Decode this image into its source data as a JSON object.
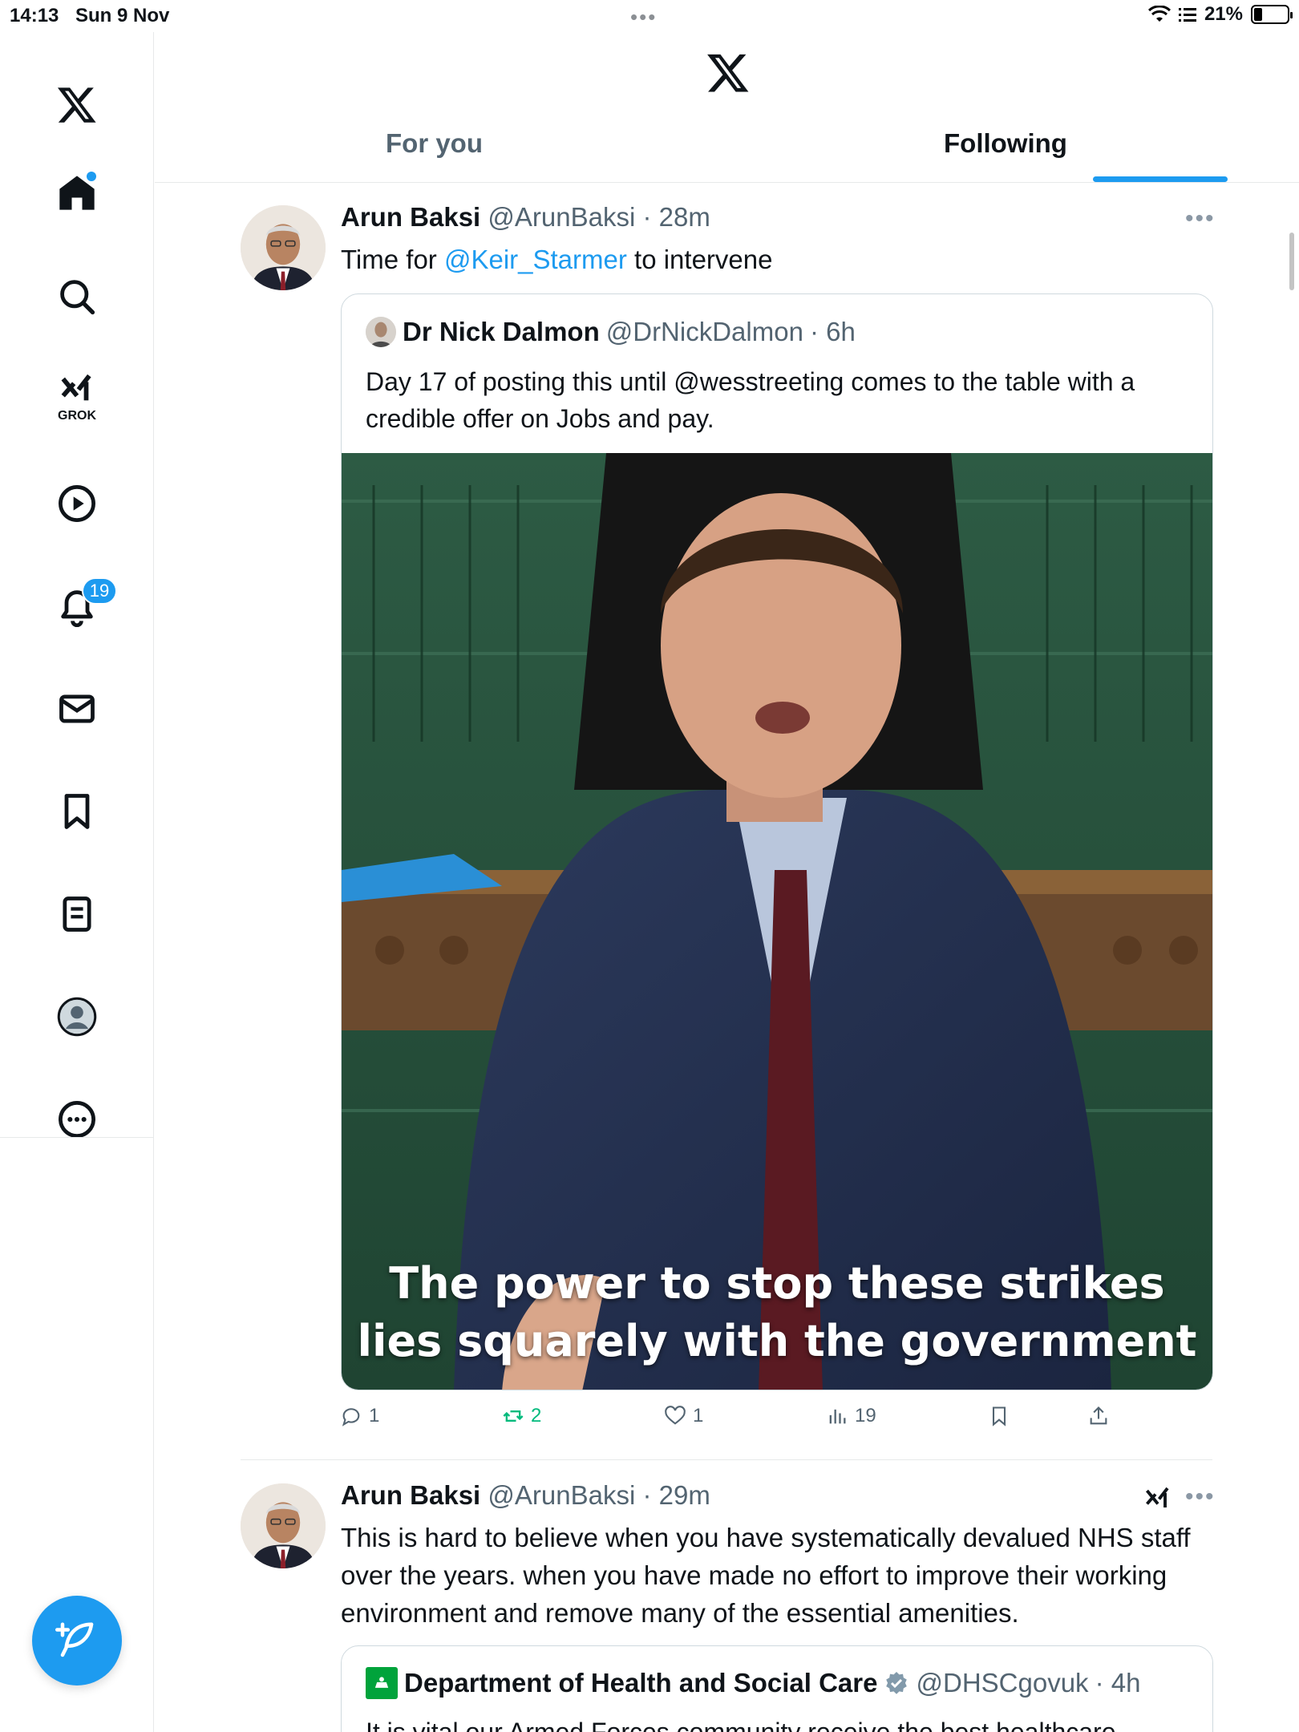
{
  "status_bar": {
    "time": "14:13",
    "date": "Sun 9 Nov",
    "battery": "21%"
  },
  "sidebar": {
    "notifications_badge": "19",
    "grok_label": "GROK"
  },
  "tabs": {
    "for_you": "For you",
    "following": "Following"
  },
  "tweets": [
    {
      "name": "Arun Baksi",
      "handle": "@ArunBaksi",
      "time": "· 28m",
      "text_before": "Time for ",
      "mention": "@Keir_Starmer",
      "text_after": " to intervene",
      "quote": {
        "name": "Dr Nick Dalmon",
        "handle": "@DrNickDalmon",
        "time": "· 6h",
        "text": "Day 17 of posting this until @wesstreeting comes to the table with a credible offer on Jobs and pay.",
        "caption_line1": "The power to stop these strikes",
        "caption_line2": "lies squarely with the government"
      },
      "actions": {
        "replies": "1",
        "reposts": "2",
        "likes": "1",
        "views": "19"
      }
    },
    {
      "name": "Arun Baksi",
      "handle": "@ArunBaksi",
      "time": "· 29m",
      "text": "This is hard to believe when you have systematically devalued NHS staff over the years. when you have  made no effort to improve their working environment  and remove many of the essential amenities.",
      "quote": {
        "name": "Department of Health and Social Care",
        "handle": "@DHSCgovuk",
        "time": "· 4h",
        "text": "It is vital our Armed Forces community receive the best healthcare"
      }
    }
  ],
  "colors": {
    "accent": "#1d9bf0",
    "repost": "#00ba7c",
    "text": "#0f1419",
    "muted": "#536471"
  }
}
